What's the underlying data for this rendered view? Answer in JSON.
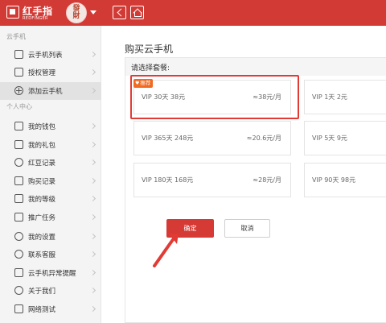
{
  "header": {
    "logo_cn": "红手指",
    "logo_en": "REDFINGER",
    "avatar_text": "發財",
    "back_icon": "back-arrow-icon",
    "home_icon": "home-icon",
    "accent_color": "#d23a35"
  },
  "sidebar": {
    "section1": "云手机",
    "section2": "个人中心",
    "items": [
      {
        "label": "云手机列表",
        "icon": "phone-icon"
      },
      {
        "label": "授权管理",
        "icon": "authorize-icon"
      },
      {
        "label": "添加云手机",
        "icon": "add-circle-icon"
      },
      {
        "label": "我的钱包",
        "icon": "wallet-icon"
      },
      {
        "label": "我的礼包",
        "icon": "gift-icon"
      },
      {
        "label": "红豆记录",
        "icon": "bean-icon"
      },
      {
        "label": "购买记录",
        "icon": "purchase-record-icon"
      },
      {
        "label": "我的等级",
        "icon": "crown-icon"
      },
      {
        "label": "推广任务",
        "icon": "flag-icon"
      },
      {
        "label": "我的设置",
        "icon": "settings-icon"
      },
      {
        "label": "联系客服",
        "icon": "headset-icon"
      },
      {
        "label": "云手机异常提醒",
        "icon": "alert-icon"
      },
      {
        "label": "关于我们",
        "icon": "info-icon"
      },
      {
        "label": "网络测试",
        "icon": "network-icon"
      }
    ],
    "active_item": "添加云手机"
  },
  "main": {
    "title": "购买云手机",
    "select_label": "请选择套餐:",
    "badge": "推荐",
    "packages": [
      {
        "name": "VIP 30天 38元",
        "price": "≈38元/月"
      },
      {
        "name": "VIP 1天 2元",
        "price": ""
      },
      {
        "name": "VIP 365天 248元",
        "price": "≈20.6元/月"
      },
      {
        "name": "VIP 5天 9元",
        "price": ""
      },
      {
        "name": "VIP 180天 168元",
        "price": "≈28元/月"
      },
      {
        "name": "VIP 90天 98元",
        "price": ""
      }
    ],
    "confirm_label": "确定",
    "cancel_label": "取消"
  }
}
